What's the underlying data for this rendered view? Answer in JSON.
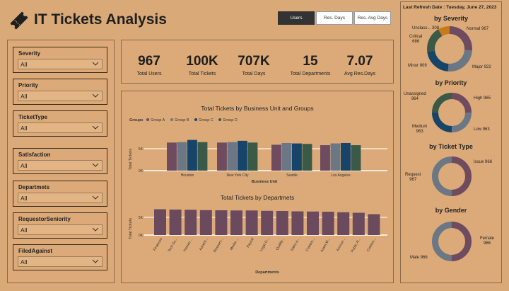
{
  "header": {
    "title": "IT Tickets Analysis",
    "icon": "ticket-icon"
  },
  "tabs": [
    {
      "label": "Users",
      "active": true
    },
    {
      "label": "Res. Days",
      "active": false
    },
    {
      "label": "Res. Avg Days",
      "active": false
    }
  ],
  "refresh": {
    "text": "Last Refresh Date : Tuesday, June 27, 2023"
  },
  "filters": [
    {
      "label": "Severity",
      "value": "All"
    },
    {
      "label": "Priority",
      "value": "All"
    },
    {
      "label": "TicketType",
      "value": "All"
    },
    {
      "label": "Satisfaction",
      "value": "All"
    },
    {
      "label": "Departmets",
      "value": "All"
    },
    {
      "label": "RequestorSeniority",
      "value": "All"
    },
    {
      "label": "FiledAgainst",
      "value": "All"
    }
  ],
  "kpis": [
    {
      "value": "967",
      "label": "Total Users"
    },
    {
      "value": "100K",
      "label": "Total Tickets"
    },
    {
      "value": "707K",
      "label": "Total Days"
    },
    {
      "value": "15",
      "label": "Total Departments"
    },
    {
      "value": "7.07",
      "label": "Avg Res.Days"
    }
  ],
  "colors": {
    "groupA": "#6e4b5e",
    "groupB": "#6b7784",
    "groupC": "#17456a",
    "groupD": "#3a5a47",
    "dept": "#6a4a5c",
    "orange": "#c97a18",
    "bg": "#d9a978"
  },
  "chart_data": [
    {
      "type": "bar",
      "title": "Total Tickets by Business Unit and Groups",
      "xlabel": "Business Unit",
      "ylabel": "Total Tickets",
      "legend_title": "Groups",
      "categories": [
        "Houston",
        "New York City",
        "Seattle",
        "Los Angeles"
      ],
      "series": [
        {
          "name": "Group A",
          "values": [
            6400,
            6400,
            5900,
            5800
          ]
        },
        {
          "name": "Group B",
          "values": [
            6500,
            6500,
            6300,
            6200
          ]
        },
        {
          "name": "Group C",
          "values": [
            7000,
            6800,
            6200,
            6300
          ]
        },
        {
          "name": "Group D",
          "values": [
            6500,
            6400,
            6100,
            5800
          ]
        }
      ],
      "yticks": [
        "0K",
        "5K"
      ],
      "ylim": [
        0,
        9200
      ]
    },
    {
      "type": "bar",
      "title": "Total Tickets by Departmets",
      "xlabel": "Departments",
      "ylabel": "Total Tickets",
      "categories": [
        "Finances",
        "Tech Su...",
        "Human ...",
        "Adverti...",
        "Researc...",
        "Media ...",
        "Payroll",
        "Legal D...",
        "Quality...",
        "Sales a...",
        "Custom...",
        "Asset M...",
        "Accoun...",
        "Public R...",
        "Custom..."
      ],
      "values": [
        7300,
        7200,
        7150,
        7050,
        7000,
        6950,
        6950,
        6850,
        6800,
        6700,
        6650,
        6600,
        6450,
        6300,
        5900
      ],
      "yticks": [
        "0K",
        "5K"
      ],
      "ylim": [
        0,
        9000
      ]
    },
    {
      "type": "pie",
      "title": "by Severity",
      "labels": [
        "Normal",
        "Major",
        "Minor",
        "Critical",
        "Unclass..."
      ],
      "values": [
        967,
        922,
        809,
        686,
        308
      ]
    },
    {
      "type": "pie",
      "title": "by Priority",
      "labels": [
        "High",
        "Low",
        "Medium",
        "Unassigned"
      ],
      "values": [
        965,
        963,
        963,
        964
      ]
    },
    {
      "type": "pie",
      "title": "by Ticket Type",
      "labels": [
        "Issue",
        "Request"
      ],
      "values": [
        966,
        967
      ]
    },
    {
      "type": "pie",
      "title": "by Gender",
      "labels": [
        "Female",
        "Male"
      ],
      "values": [
        966,
        966
      ]
    }
  ]
}
